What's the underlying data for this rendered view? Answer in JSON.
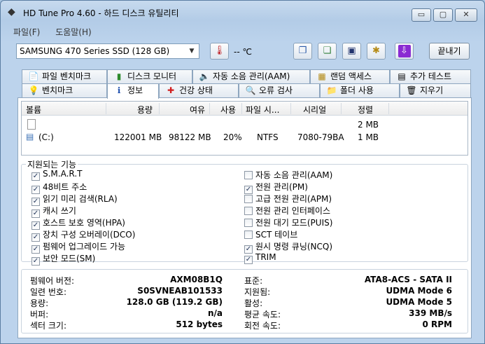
{
  "window": {
    "title": "HD Tune Pro 4.60 - 하드 디스크 유틸리티",
    "controls": {
      "minimize": "▭",
      "maximize": "▢",
      "close": "✕"
    }
  },
  "menu": [
    {
      "label": "파일(F)"
    },
    {
      "label": "도움말(H)"
    }
  ],
  "toolbar": {
    "drive": "SAMSUNG 470 Series SSD (128 GB)",
    "temperature": "-- ℃",
    "exit_label": "끝내기"
  },
  "tabs_top": [
    {
      "label": "파일 벤치마크",
      "icon": "file-benchmark-icon"
    },
    {
      "label": "디스크 모니터",
      "icon": "disk-monitor-icon"
    },
    {
      "label": "자동 소음 관리(AAM)",
      "icon": "speaker-icon"
    },
    {
      "label": "랜덤 액세스",
      "icon": "random-access-icon"
    },
    {
      "label": "추가 테스트",
      "icon": "extra-tests-icon"
    }
  ],
  "tabs_bottom": [
    {
      "label": "벤치마크",
      "icon": "benchmark-icon"
    },
    {
      "label": "정보",
      "icon": "info-icon"
    },
    {
      "label": "건강 상태",
      "icon": "health-cross-icon"
    },
    {
      "label": "오류 검사",
      "icon": "magnifier-icon"
    },
    {
      "label": "폴더 사용",
      "icon": "folder-icon"
    },
    {
      "label": "지우기",
      "icon": "trash-icon"
    }
  ],
  "volumes": {
    "headers": [
      "볼륨",
      "용량",
      "여유",
      "사용",
      "파일 시...",
      "시리얼",
      "정렬"
    ],
    "rows": [
      {
        "volume": "",
        "capacity": "",
        "free": "",
        "usage": "",
        "fs": "",
        "serial": "",
        "align": "2 MB"
      },
      {
        "volume": "(C:)",
        "capacity": "122001 MB",
        "free": "98122 MB",
        "usage": "20%",
        "fs": "NTFS",
        "serial": "7080-79BA",
        "align": "1 MB"
      }
    ]
  },
  "features": {
    "title": "지원되는 기능",
    "left": [
      {
        "label": "S.M.A.R.T",
        "checked": true
      },
      {
        "label": "48비트 주소",
        "checked": true
      },
      {
        "label": "읽기 미리 검색(RLA)",
        "checked": true
      },
      {
        "label": "캐시 쓰기",
        "checked": true
      },
      {
        "label": "호스트 보호 영역(HPA)",
        "checked": true
      },
      {
        "label": "장치 구성 오버레이(DCO)",
        "checked": true
      },
      {
        "label": "펌웨어 업그레이드 가능",
        "checked": true
      },
      {
        "label": "보안 모드(SM)",
        "checked": true
      }
    ],
    "right": [
      {
        "label": "자동 소음 관리(AAM)",
        "checked": false
      },
      {
        "label": "전원 관리(PM)",
        "checked": true
      },
      {
        "label": "고급 전원 관리(APM)",
        "checked": false
      },
      {
        "label": "전원 관리 인터페이스",
        "checked": false
      },
      {
        "label": "전원 대기 모드(PUIS)",
        "checked": false
      },
      {
        "label": "SCT 테이브",
        "checked": false
      },
      {
        "label": "원시 명령 큐닝(NCQ)",
        "checked": true
      },
      {
        "label": "TRIM",
        "checked": true
      }
    ]
  },
  "details": {
    "left": [
      {
        "label": "펌웨어 버전:",
        "value": "AXM08B1Q"
      },
      {
        "label": "일련 번호:",
        "value": "S0SVNEAB101533"
      },
      {
        "label": "용량:",
        "value": "128.0 GB (119.2 GB)"
      },
      {
        "label": "버퍼:",
        "value": "n/a"
      },
      {
        "label": "섹터 크기:",
        "value": "512 bytes"
      }
    ],
    "right": [
      {
        "label": "표준:",
        "value": "ATA8-ACS - SATA II"
      },
      {
        "label": "지원됨:",
        "value": "UDMA Mode 6"
      },
      {
        "label": "활성:",
        "value": "UDMA Mode 5"
      },
      {
        "label": "평균 속도:",
        "value": "339 MB/s"
      },
      {
        "label": "회전 속도:",
        "value": "0 RPM"
      }
    ]
  }
}
